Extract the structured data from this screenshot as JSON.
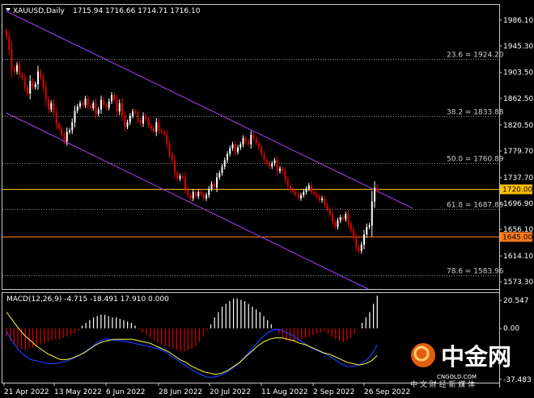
{
  "chart_data": [
    {
      "type": "candlestick",
      "symbol_label": "XAUUSD,Daily",
      "ohlc_label": "1715.94 1716.66 1714.71 1716.10",
      "y_ticks": [
        1986.1,
        1945.3,
        1903.5,
        1862.5,
        1820.5,
        1779.7,
        1737.7,
        1696.9,
        1656.1,
        1614.1,
        1573.3
      ],
      "ylim": [
        1562,
        2010
      ],
      "x_ticks": [
        "21 Apr 2022",
        "13 May 2022",
        "6 Jun 2022",
        "28 Jun 2022",
        "20 Jul 2022",
        "11 Aug 2022",
        "2 Sep 2022",
        "26 Sep 2022"
      ],
      "fib_levels": [
        {
          "label": "23.6 = 1924.20",
          "value": 1924.2
        },
        {
          "label": "38.2 = 1833.88",
          "value": 1833.88
        },
        {
          "label": "50.0 = 1760.89",
          "value": 1760.89
        },
        {
          "label": "61.8 = 1687.89",
          "value": 1687.89
        },
        {
          "label": "78.6 = 1583.96",
          "value": 1583.96
        }
      ],
      "horizontal_lines": [
        {
          "label": "1720.00",
          "value": 1720.0,
          "color": "#ffbf00"
        },
        {
          "label": "1645.00",
          "value": 1645.0,
          "color": "#ff7a1a"
        }
      ],
      "colors": {
        "up": "#ffffff",
        "down": "#e00000",
        "channel": "#a040ff",
        "fib": "#8c8c8c"
      },
      "close": [
        1960,
        1940,
        1910,
        1905,
        1915,
        1900,
        1895,
        1880,
        1870,
        1890,
        1880,
        1885,
        1905,
        1895,
        1880,
        1860,
        1845,
        1855,
        1840,
        1822,
        1815,
        1805,
        1795,
        1810,
        1812,
        1825,
        1843,
        1850,
        1855,
        1852,
        1862,
        1850,
        1847,
        1855,
        1838,
        1845,
        1860,
        1852,
        1848,
        1858,
        1868,
        1860,
        1842,
        1855,
        1835,
        1818,
        1825,
        1835,
        1842,
        1840,
        1828,
        1823,
        1835,
        1830,
        1820,
        1815,
        1810,
        1825,
        1812,
        1810,
        1806,
        1790,
        1775,
        1765,
        1745,
        1736,
        1740,
        1738,
        1720,
        1710,
        1705,
        1715,
        1708,
        1715,
        1712,
        1705,
        1710,
        1720,
        1728,
        1722,
        1738,
        1745,
        1755,
        1765,
        1775,
        1784,
        1790,
        1778,
        1785,
        1790,
        1800,
        1795,
        1790,
        1805,
        1800,
        1792,
        1785,
        1775,
        1765,
        1760,
        1755,
        1760,
        1765,
        1748,
        1752,
        1748,
        1735,
        1725,
        1718,
        1715,
        1712,
        1705,
        1710,
        1715,
        1720,
        1725,
        1715,
        1712,
        1708,
        1702,
        1705,
        1695,
        1688,
        1680,
        1668,
        1660,
        1670,
        1675,
        1672,
        1680,
        1665,
        1655,
        1643,
        1628,
        1622,
        1632,
        1648,
        1660,
        1662,
        1700,
        1722,
        1716
      ],
      "macd": {
        "label": "MACD(12,26,9) -4.715 -18.491 17.910 0.000",
        "y_ticks": [
          20.547,
          0.0,
          -37.483
        ],
        "ylim": [
          -40,
          26
        ],
        "histogram": [
          -6,
          -9,
          -12,
          -14,
          -15,
          -16,
          -15,
          -14,
          -13,
          -12,
          -11,
          -10,
          -9,
          -8,
          -8,
          -7,
          -6,
          -5,
          -4,
          -2,
          2,
          4,
          6,
          8,
          9,
          10,
          10,
          9,
          8,
          8,
          7,
          6,
          5,
          4,
          2,
          -1,
          -3,
          -5,
          -7,
          -9,
          -11,
          -12,
          -13,
          -14,
          -15,
          -16,
          -17,
          -17,
          -16,
          -15,
          -13,
          -10,
          -6,
          -2,
          3,
          8,
          12,
          16,
          18,
          20,
          22,
          22,
          21,
          20,
          18,
          16,
          14,
          12,
          9,
          6,
          3,
          -1,
          -4,
          -7,
          -9,
          -10,
          -10,
          -9,
          -8,
          -7,
          -6,
          -5,
          -4,
          -3,
          -2,
          -4,
          -6,
          -8,
          -9,
          -10,
          -9,
          -7,
          -4,
          0,
          4,
          8,
          12,
          18,
          24
        ],
        "macd_line": [
          -2,
          -10,
          -16,
          -20,
          -23,
          -24,
          -25,
          -26,
          -26,
          -25,
          -24,
          -22,
          -20,
          -17,
          -14,
          -10,
          -8,
          -8,
          -9,
          -9,
          -10,
          -11,
          -12,
          -13,
          -14,
          -15,
          -17,
          -20,
          -23,
          -26,
          -29,
          -32,
          -34,
          -36,
          -36,
          -35,
          -33,
          -30,
          -27,
          -22,
          -17,
          -12,
          -7,
          -3,
          -1,
          -1,
          -3,
          -5,
          -8,
          -11,
          -14,
          -16,
          -18,
          -20,
          -23,
          -26,
          -28,
          -28,
          -27,
          -24,
          -20,
          -12
        ],
        "signal_line": [
          12,
          6,
          0,
          -5,
          -9,
          -13,
          -16,
          -19,
          -21,
          -23,
          -23,
          -22,
          -20,
          -18,
          -15,
          -12,
          -10,
          -9,
          -8,
          -8,
          -8,
          -8,
          -9,
          -10,
          -11,
          -13,
          -15,
          -17,
          -20,
          -23,
          -25,
          -28,
          -30,
          -32,
          -33,
          -34,
          -33,
          -31,
          -28,
          -25,
          -21,
          -17,
          -13,
          -10,
          -8,
          -7,
          -7,
          -8,
          -9,
          -11,
          -12,
          -14,
          -16,
          -18,
          -19,
          -21,
          -23,
          -25,
          -26,
          -27,
          -26,
          -24,
          -20
        ]
      }
    }
  ],
  "watermark": {
    "brand": "中金网",
    "site": "CNGOLD.COM",
    "slogan": "中 文 财 经 新 媒 体"
  }
}
